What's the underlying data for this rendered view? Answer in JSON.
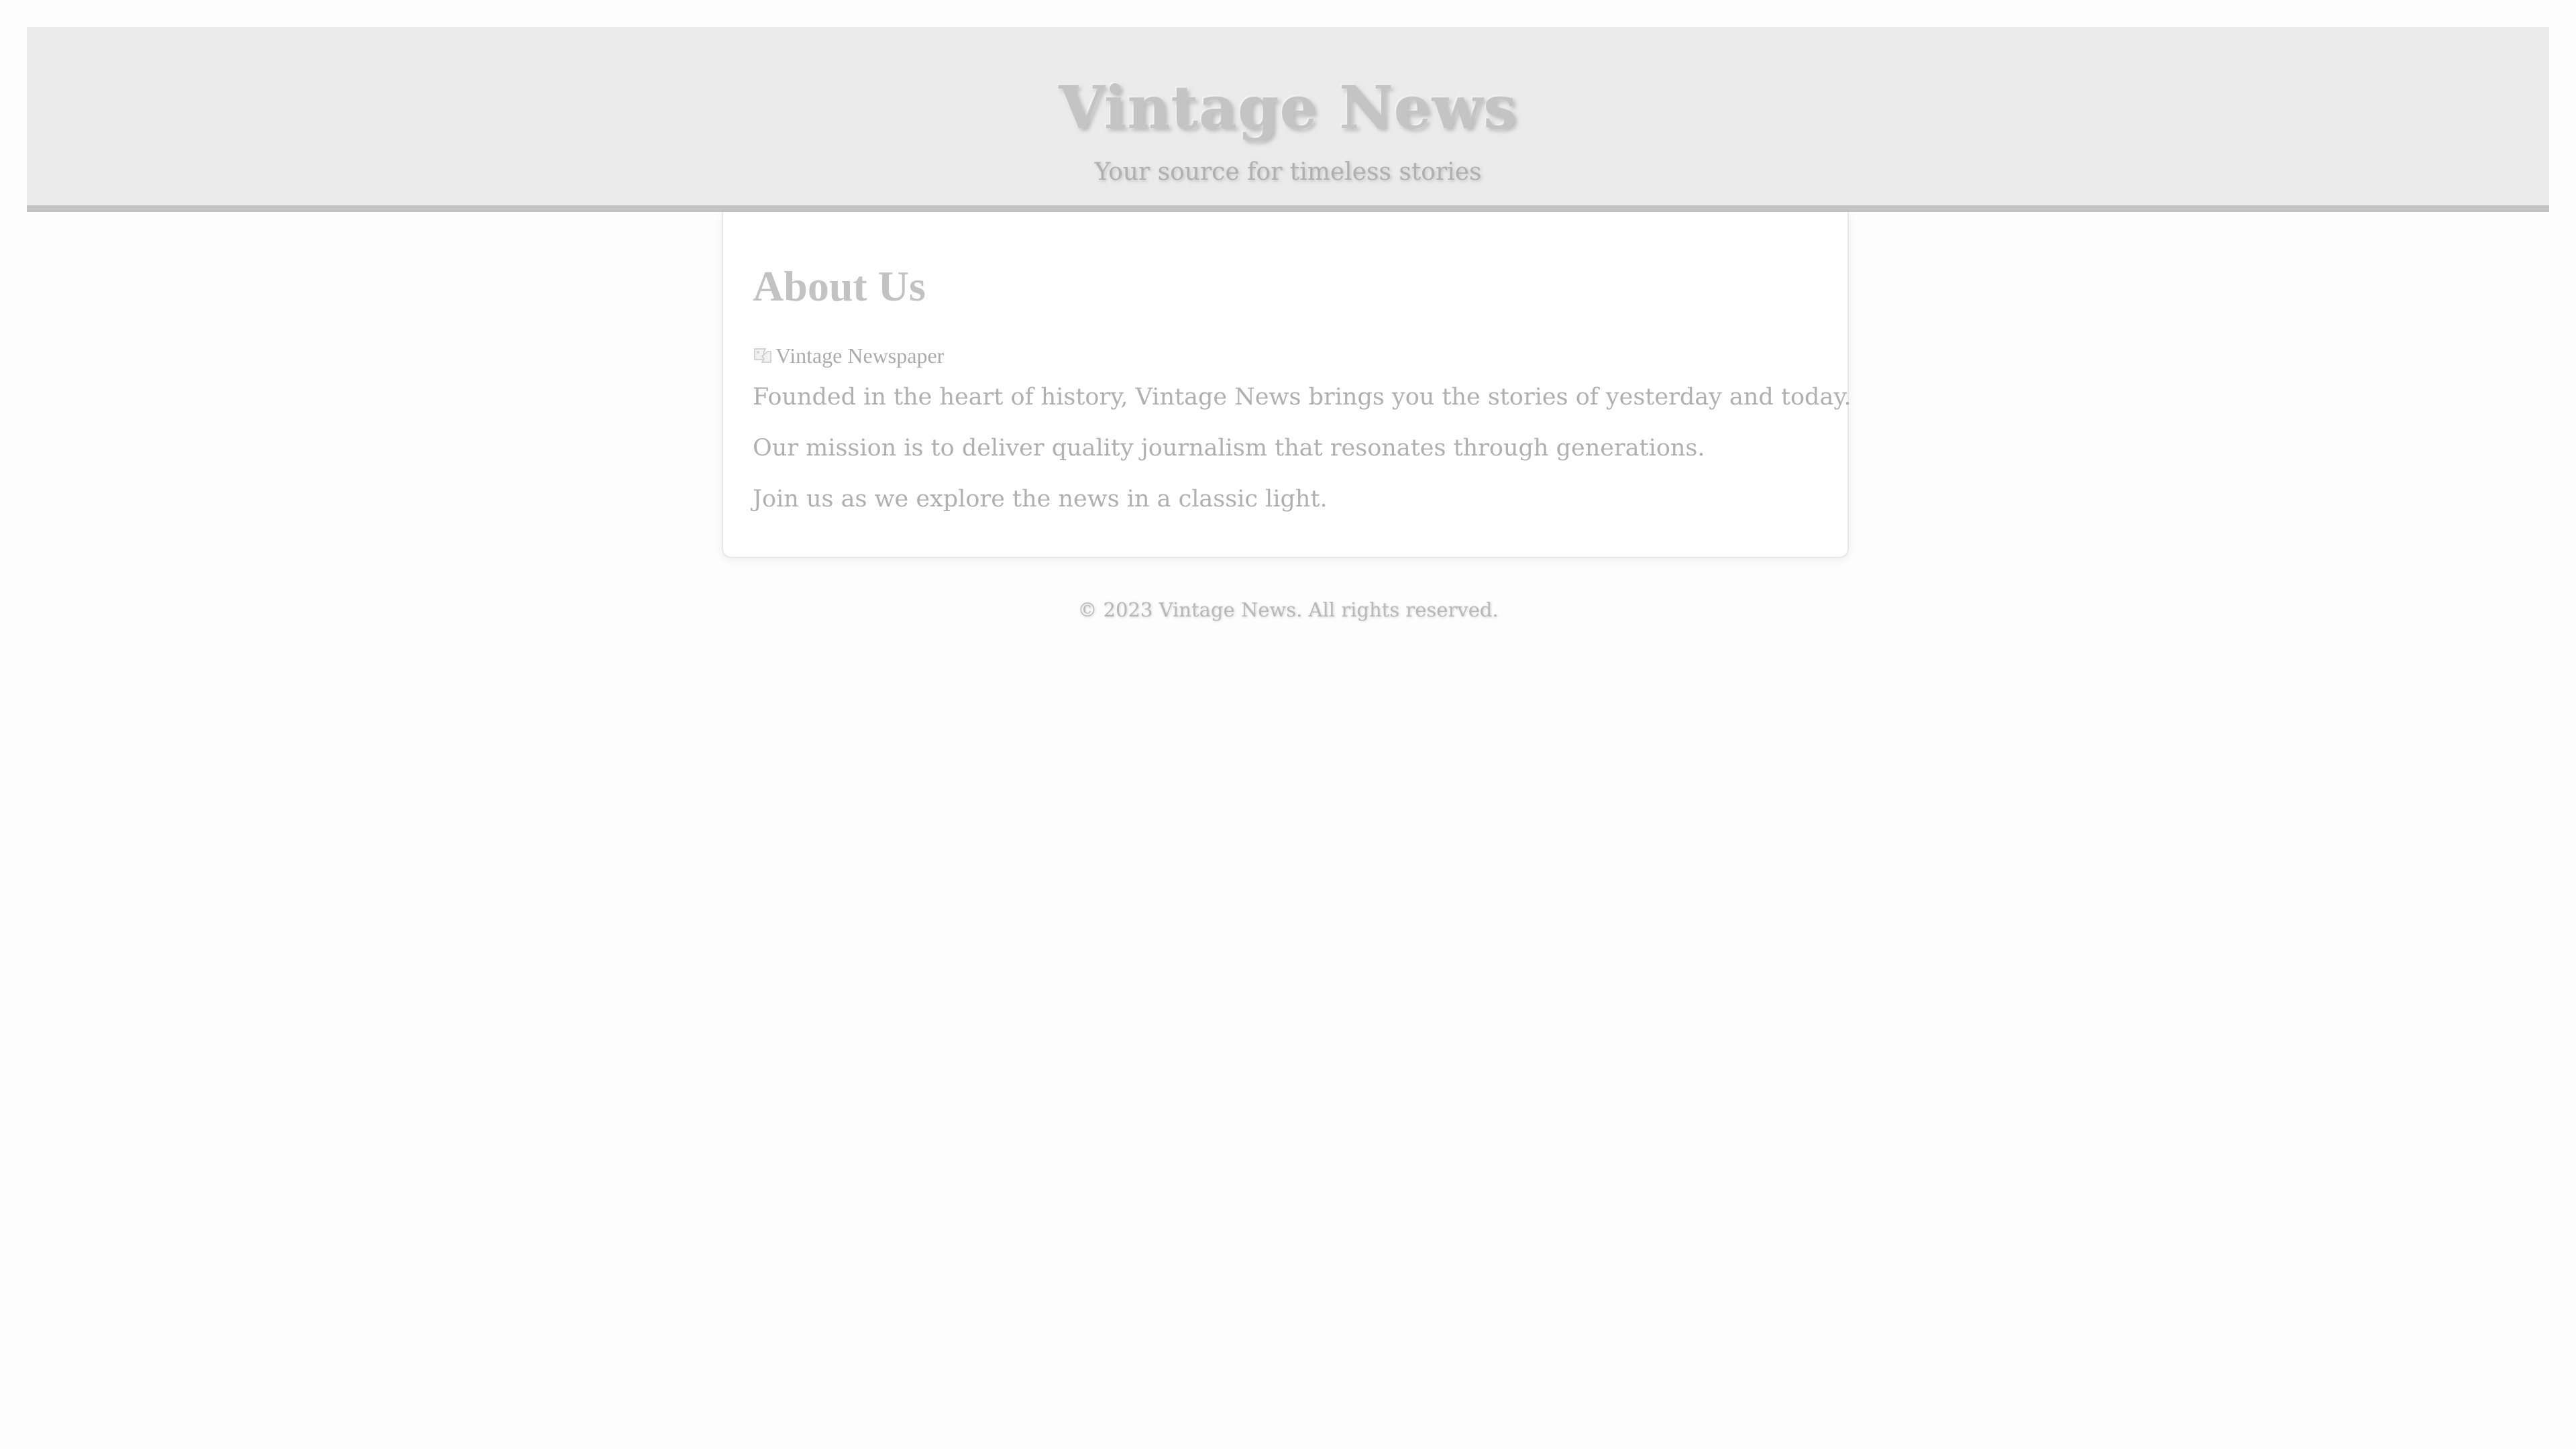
{
  "header": {
    "title": "Vintage News",
    "tagline": "Your source for timeless stories"
  },
  "about": {
    "heading": "About Us",
    "image_alt": "Vintage Newspaper",
    "paragraphs": [
      "Founded in the heart of history, Vintage News brings you the stories of yesterday and today.",
      "Our mission is to deliver quality journalism that resonates through generations.",
      "Join us as we explore the news in a classic light."
    ]
  },
  "footer": {
    "copyright": "© 2023 Vintage News. All rights reserved."
  },
  "icons": {
    "broken_image": "broken-image-icon"
  },
  "colors": {
    "page_background": "#fdfdfd",
    "header_background": "#ebebeb",
    "header_border": "#c4c4c4",
    "card_background": "#ffffff",
    "text": "#b0b0b0"
  }
}
